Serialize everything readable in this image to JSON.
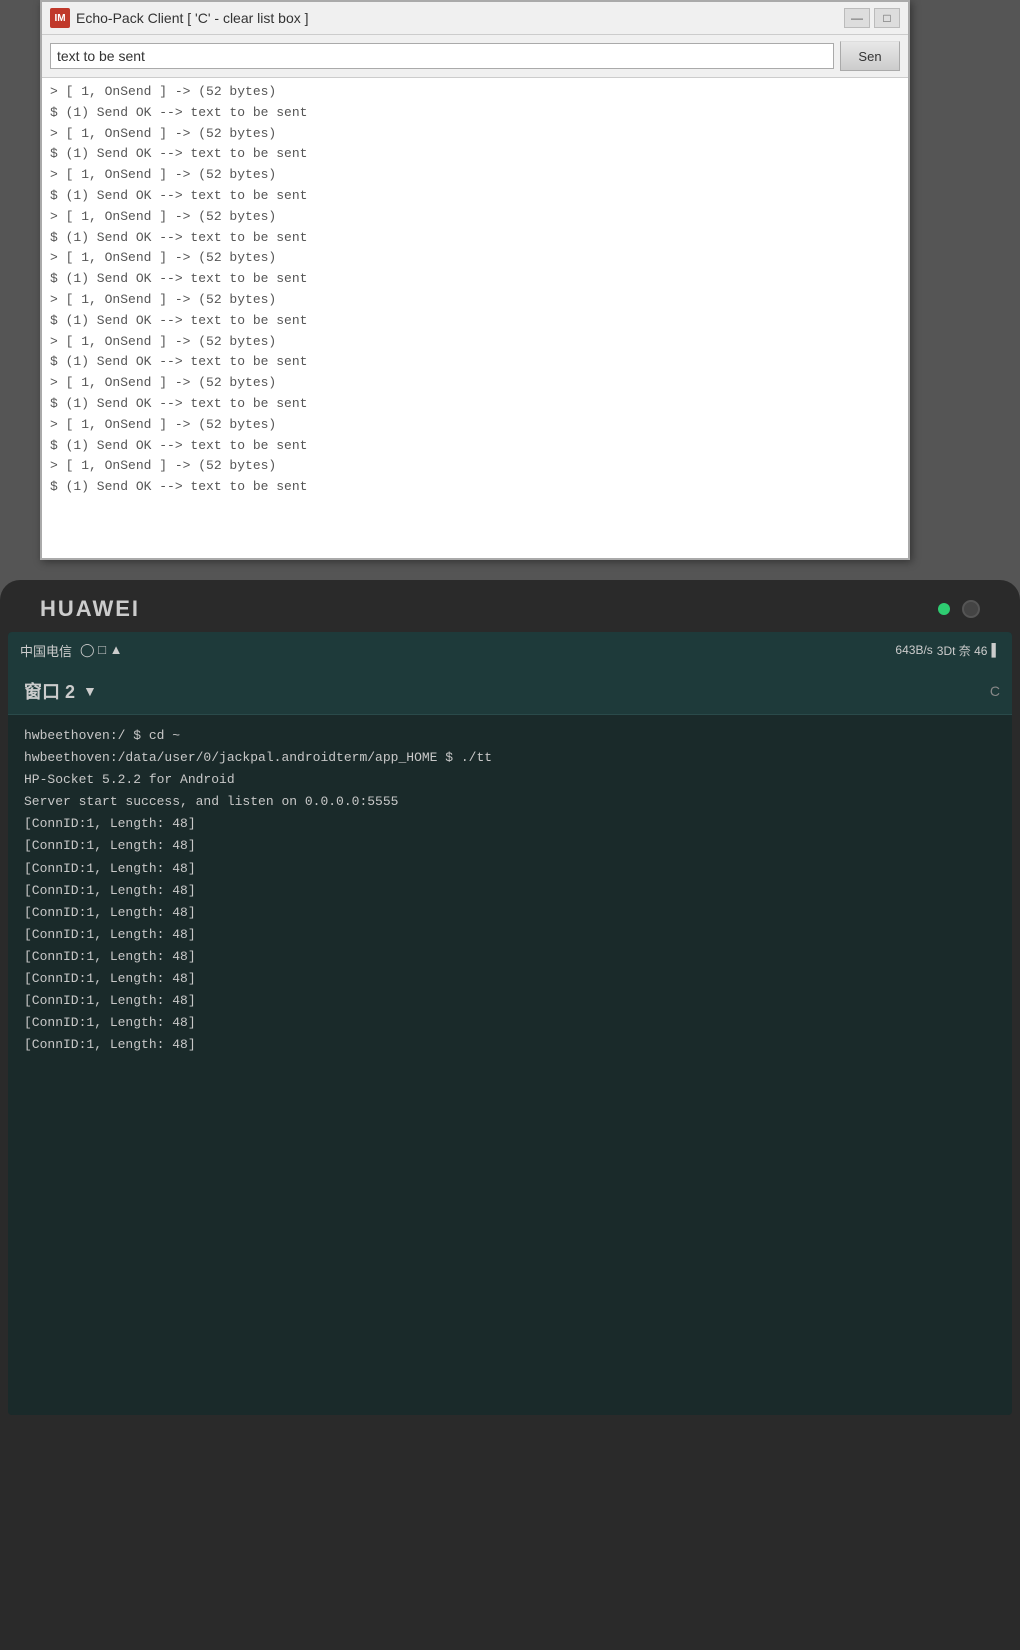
{
  "win_app": {
    "title": "Echo-Pack Client [ 'C' - clear list box ]",
    "icon_label": "IM",
    "input_value": "text to be sent",
    "send_button_label": "Sen",
    "minimize_label": "—",
    "maximize_label": "□",
    "log_lines": [
      "  > [ 1, OnSend ] -> (52 bytes)",
      "$ (1) Send OK --> text to be sent",
      "  > [ 1, OnSend ] -> (52 bytes)",
      "$ (1) Send OK --> text to be sent",
      "  > [ 1, OnSend ] -> (52 bytes)",
      "$ (1) Send OK --> text to be sent",
      "  > [ 1, OnSend ] -> (52 bytes)",
      "$ (1) Send OK --> text to be sent",
      "  > [ 1, OnSend ] -> (52 bytes)",
      "$ (1) Send OK --> text to be sent",
      "  > [ 1, OnSend ] -> (52 bytes)",
      "$ (1) Send OK --> text to be sent",
      "  > [ 1, OnSend ] -> (52 bytes)",
      "$ (1) Send OK --> text to be sent",
      "  > [ 1, OnSend ] -> (52 bytes)",
      "$ (1) Send OK --> text to be sent",
      "  > [ 1, OnSend ] -> (52 bytes)",
      "$ (1) Send OK --> text to be sent",
      "  > [ 1, OnSend ] -> (52 bytes)",
      "$ (1) Send OK --> text to be sent"
    ]
  },
  "tablet": {
    "brand": "HUAWEI",
    "statusbar": {
      "carrier": "中国电信",
      "icons": "◯ □ ▲",
      "speed": "643B/s",
      "signal_icons": "3Dt 奈 46",
      "battery": "▌"
    },
    "window_label": "窗口 2",
    "corner_label": "C",
    "terminal": {
      "lines": [
        "hwbeethoven:/ $ cd ~",
        "hwbeethoven:/data/user/0/jackpal.androidterm/app_HOME $ ./tt",
        "HP-Socket 5.2.2 for Android",
        "Server start success, and listen on 0.0.0.0:5555",
        "[ConnID:1, Length: 48]",
        "[ConnID:1, Length: 48]",
        "[ConnID:1, Length: 48]",
        "[ConnID:1, Length: 48]",
        "[ConnID:1, Length: 48]",
        "[ConnID:1, Length: 48]",
        "[ConnID:1, Length: 48]",
        "[ConnID:1, Length: 48]",
        "[ConnID:1, Length: 48]",
        "[ConnID:1, Length: 48]",
        "[ConnID:1, Length: 48]"
      ]
    }
  }
}
